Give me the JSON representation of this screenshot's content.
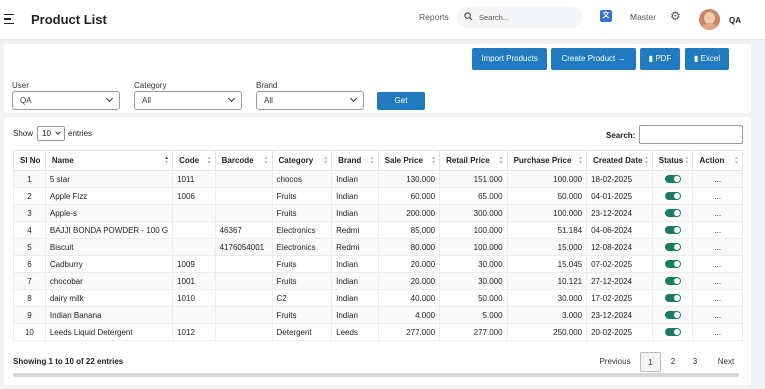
{
  "header": {
    "title": "Product List",
    "reports": "Reports",
    "search_placeholder": "Search...",
    "master": "Master",
    "user": "QA"
  },
  "actions": {
    "import": "Import Products",
    "create": "Create Product",
    "pdf": "PDF",
    "excel": "Excel"
  },
  "filters": {
    "user_label": "User",
    "user_value": "QA",
    "category_label": "Category",
    "category_value": "All",
    "brand_label": "Brand",
    "brand_value": "All",
    "get": "Get"
  },
  "table_controls": {
    "show": "Show",
    "page_size": "10",
    "entries": "entries",
    "search_label": "Search:"
  },
  "columns": [
    "Sl No",
    "Name",
    "Code",
    "Barcode",
    "Category",
    "Brand",
    "Sale Price",
    "Retail Price",
    "Purchase Price",
    "Created Date",
    "Status",
    "Action"
  ],
  "rows": [
    {
      "sl": "1",
      "name": "5 star",
      "code": "1011",
      "barcode": "",
      "category": "chocos",
      "brand": "Indian",
      "sale": "130.000",
      "retail": "151.000",
      "purchase": "100.000",
      "date": "18-02-2025",
      "action": "..."
    },
    {
      "sl": "2",
      "name": "Apple Fizz",
      "code": "1006",
      "barcode": "",
      "category": "Fruits",
      "brand": "Indian",
      "sale": "60.000",
      "retail": "65.000",
      "purchase": "50.000",
      "date": "04-01-2025",
      "action": "..."
    },
    {
      "sl": "3",
      "name": "Apple-s",
      "code": "",
      "barcode": "",
      "category": "Fruits",
      "brand": "Indian",
      "sale": "200.000",
      "retail": "300.000",
      "purchase": "100.000",
      "date": "23-12-2024",
      "action": "..."
    },
    {
      "sl": "4",
      "name": "BAJJI BONDA POWDER - 100 G",
      "code": "",
      "barcode": "46367",
      "category": "Electronics",
      "brand": "Redmi",
      "sale": "85.000",
      "retail": "100.000",
      "purchase": "51.184",
      "date": "04-06-2024",
      "action": "..."
    },
    {
      "sl": "5",
      "name": "Biscuit",
      "code": "",
      "barcode": "4176054001",
      "category": "Electronics",
      "brand": "Redmi",
      "sale": "80.000",
      "retail": "100.000",
      "purchase": "15.000",
      "date": "12-08-2024",
      "action": "..."
    },
    {
      "sl": "6",
      "name": "Cadburry",
      "code": "1009",
      "barcode": "",
      "category": "Fruits",
      "brand": "Indian",
      "sale": "20.000",
      "retail": "30.000",
      "purchase": "15.045",
      "date": "07-02-2025",
      "action": "..."
    },
    {
      "sl": "7",
      "name": "chocobar",
      "code": "1001",
      "barcode": "",
      "category": "Fruits",
      "brand": "Indian",
      "sale": "20.000",
      "retail": "30.000",
      "purchase": "10.121",
      "date": "27-12-2024",
      "action": "..."
    },
    {
      "sl": "8",
      "name": "dairy milk",
      "code": "1010",
      "barcode": "",
      "category": "C2",
      "brand": "Indian",
      "sale": "40.000",
      "retail": "50.000",
      "purchase": "30.000",
      "date": "17-02-2025",
      "action": "..."
    },
    {
      "sl": "9",
      "name": "Indian Banana",
      "code": "",
      "barcode": "",
      "category": "Fruits",
      "brand": "Indian",
      "sale": "4.000",
      "retail": "5.000",
      "purchase": "3.000",
      "date": "23-12-2024",
      "action": "..."
    },
    {
      "sl": "10",
      "name": "Leeds Liquid Detergent",
      "code": "1012",
      "barcode": "",
      "category": "Detergent",
      "brand": "Leeds",
      "sale": "277.000",
      "retail": "277.000",
      "purchase": "250.000",
      "date": "20-02-2025",
      "action": "..."
    }
  ],
  "footer": {
    "showing": "Showing 1 to 10 of 22 entries",
    "previous": "Previous",
    "pages": [
      "1",
      "2",
      "3"
    ],
    "next": "Next"
  },
  "colors": {
    "primary": "#1f7ac0",
    "toggle_on": "#1a7d63"
  }
}
